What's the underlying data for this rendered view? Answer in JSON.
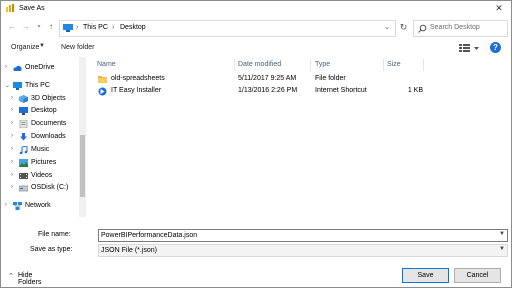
{
  "window": {
    "title": "Save As"
  },
  "nav": {
    "address": {
      "root": "This PC",
      "folder": "Desktop"
    },
    "search_placeholder": "Search Desktop"
  },
  "toolbar": {
    "organize": "Organize",
    "new_folder": "New folder"
  },
  "sidebar": {
    "items": [
      {
        "label": "OneDrive",
        "icon": "cloud-icon"
      },
      {
        "label": "This PC",
        "icon": "computer-icon"
      },
      {
        "label": "3D Objects",
        "icon": "cube-icon"
      },
      {
        "label": "Desktop",
        "icon": "desktop-icon"
      },
      {
        "label": "Documents",
        "icon": "documents-icon"
      },
      {
        "label": "Downloads",
        "icon": "downloads-icon"
      },
      {
        "label": "Music",
        "icon": "music-icon"
      },
      {
        "label": "Pictures",
        "icon": "pictures-icon"
      },
      {
        "label": "Videos",
        "icon": "videos-icon"
      },
      {
        "label": "OSDisk (C:)",
        "icon": "drive-icon"
      },
      {
        "label": "Network",
        "icon": "network-icon"
      }
    ]
  },
  "file_list": {
    "columns": {
      "name": "Name",
      "date": "Date modified",
      "type": "Type",
      "size": "Size"
    },
    "rows": [
      {
        "name": "old-spreadsheets",
        "date": "5/11/2017 9:25 AM",
        "type": "File folder",
        "size": "",
        "icon": "folder-icon"
      },
      {
        "name": "IT Easy Installer",
        "date": "1/13/2016 2:26 PM",
        "type": "Internet Shortcut",
        "size": "1 KB",
        "icon": "shortcut-icon"
      }
    ]
  },
  "form": {
    "file_name_label": "File name:",
    "file_name_value": "PowerBIPerformanceData.json",
    "save_type_label": "Save as type:",
    "save_type_value": "JSON File (*.json)"
  },
  "footer": {
    "hide_folders": "Hide Folders",
    "save": "Save",
    "cancel": "Cancel"
  },
  "colors": {
    "accent": "#0078d7",
    "folder": "#e8b84a",
    "header_text": "#4c607a"
  }
}
